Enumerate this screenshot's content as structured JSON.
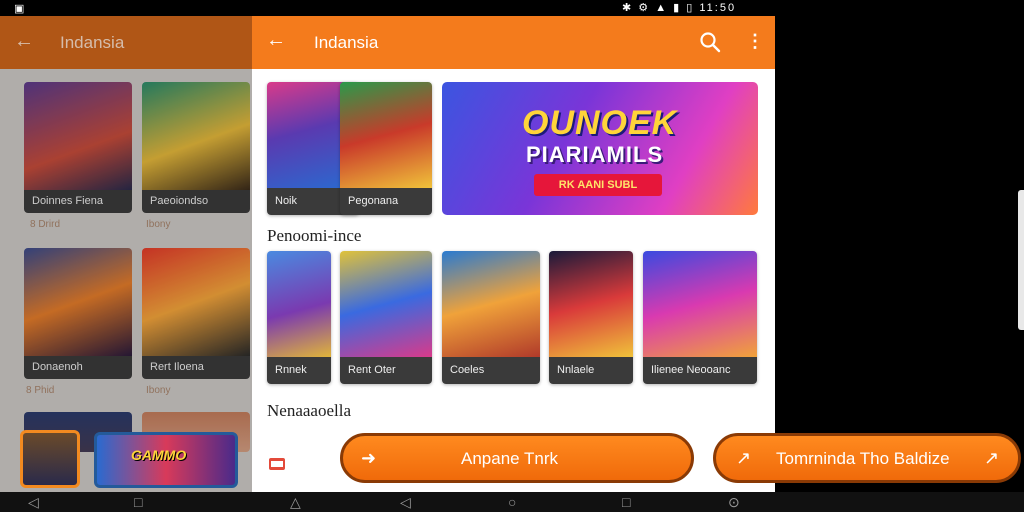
{
  "status_bar": {
    "time": "11:50",
    "left_icon": "square-icon",
    "right_icons": [
      "bluetooth-icon",
      "settings-icon",
      "wifi-icon",
      "signal-icon",
      "battery-icon"
    ]
  },
  "background_app": {
    "title": "Indansia",
    "grid": [
      {
        "label": "Doinnes Fiena",
        "sub": "8 Drird"
      },
      {
        "label": "Paeoiondso",
        "sub": "Ibony"
      },
      {
        "label": "Donaenoh",
        "sub": "8 Phid"
      },
      {
        "label": "Rert Iloena",
        "sub": "Ibony"
      }
    ]
  },
  "app": {
    "title": "Indansia",
    "top_row": [
      {
        "label": "Noik"
      },
      {
        "label": "Pegonana"
      }
    ],
    "banner": {
      "title": "OUNOEK",
      "subtitle": "PIARIAMILS",
      "tagline": "RK AANI SUBL"
    },
    "section1": {
      "title": "Penoomi-ince"
    },
    "row2": [
      {
        "label": "Rnnek"
      },
      {
        "label": "Rent Oter"
      },
      {
        "label": "Coeles"
      },
      {
        "label": "Nnlaele"
      },
      {
        "label": "Ilienee Neooanc"
      }
    ],
    "section2": {
      "title": "Nenaaaoella"
    }
  },
  "floating": {
    "primary_label": "Anpane Tnrk",
    "secondary_label": "Tomrninda Tho Baldize"
  },
  "thumb_text": "GAMMO",
  "colors": {
    "accent": "#f47b1c",
    "accent_dark": "#c9621a",
    "caption_bg": "#3a3a3a"
  }
}
